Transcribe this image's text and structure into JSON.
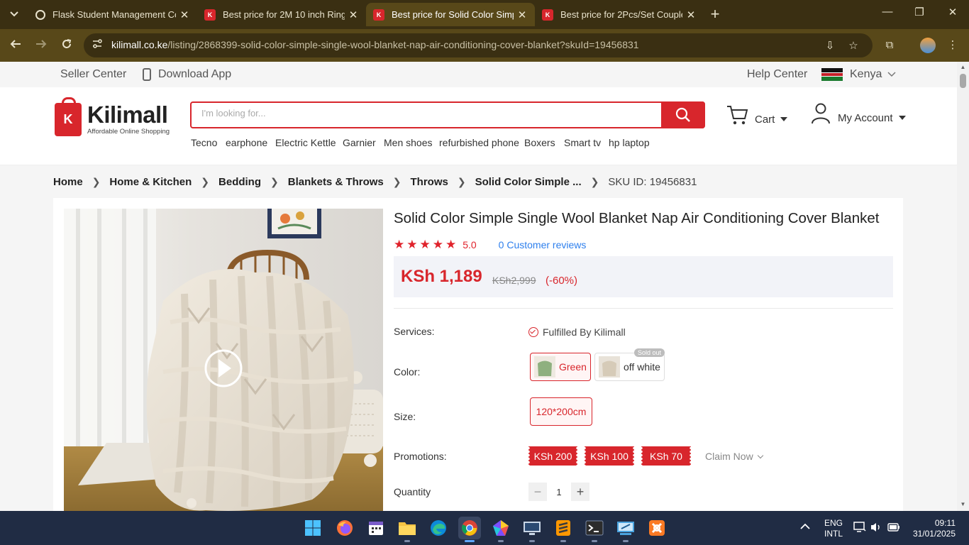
{
  "browser": {
    "tabs": [
      {
        "title": "Flask Student Management Co",
        "favicon": "chatgpt-icon",
        "active": false
      },
      {
        "title": "Best price for 2M 10 inch Ring",
        "favicon": "kilimall-icon",
        "active": false
      },
      {
        "title": "Best price for Solid Color Simpl",
        "favicon": "kilimall-icon",
        "active": true
      },
      {
        "title": "Best price for 2Pcs/Set Couple",
        "favicon": "kilimall-icon",
        "active": false
      }
    ],
    "url_host": "kilimall.co.ke",
    "url_path": "/listing/2868399-solid-color-simple-single-wool-blanket-nap-air-conditioning-cover-blanket?skuId=19456831",
    "colors": {
      "frame": "#3a2f12",
      "toolbar": "#584819"
    }
  },
  "topbar": {
    "seller_center": "Seller Center",
    "download_app": "Download App",
    "help_center": "Help Center",
    "country": "Kenya"
  },
  "header": {
    "logo_name": "Kilimall",
    "logo_tagline": "Affordable Online Shopping",
    "logo_letter": "K",
    "search_placeholder": "I'm looking for...",
    "hot_searches": [
      "Tecno",
      "earphone",
      "Electric Kettle",
      "Garnier",
      "Men shoes",
      "refurbished phone",
      "Boxers",
      "Smart tv",
      "hp laptop"
    ],
    "cart_label": "Cart",
    "account_label": "My Account",
    "brand_color": "#d8262c"
  },
  "breadcrumbs": {
    "items": [
      "Home",
      "Home & Kitchen",
      "Bedding",
      "Blankets & Throws",
      "Throws",
      "Solid Color Simple ..."
    ],
    "sku": "SKU ID: 19456831"
  },
  "product": {
    "title": "Solid Color Simple Single Wool Blanket Nap Air Conditioning Cover Blanket",
    "rating_stars": "★★★★★",
    "rating": "5.0",
    "reviews": "0 Customer reviews",
    "price": "KSh 1,189",
    "old_price": "KSh2,999",
    "discount": "(-60%)",
    "services_label": "Services:",
    "service": "Fulfilled By Kilimall",
    "color_label": "Color:",
    "colors": [
      {
        "name": "Green",
        "selected": true
      },
      {
        "name": "off white",
        "selected": false,
        "badge": "Sold out"
      }
    ],
    "size_label": "Size:",
    "size": "120*200cm",
    "promotions_label": "Promotions:",
    "coupons": [
      "KSh 200",
      "KSh 100",
      "KSh 70"
    ],
    "claim": "Claim Now",
    "quantity_label": "Quantity",
    "quantity": "1"
  },
  "taskbar": {
    "icons": [
      "windows-start-icon",
      "firefox-icon",
      "calendar-app-icon",
      "file-explorer-icon",
      "edge-icon",
      "chrome-icon",
      "gem-app-icon",
      "remote-desktop-icon",
      "sublime-text-icon",
      "terminal-icon",
      "code-editor-icon",
      "xampp-icon"
    ],
    "lang_top": "ENG",
    "lang_bottom": "INTL",
    "time": "09:11",
    "date": "31/01/2025"
  }
}
